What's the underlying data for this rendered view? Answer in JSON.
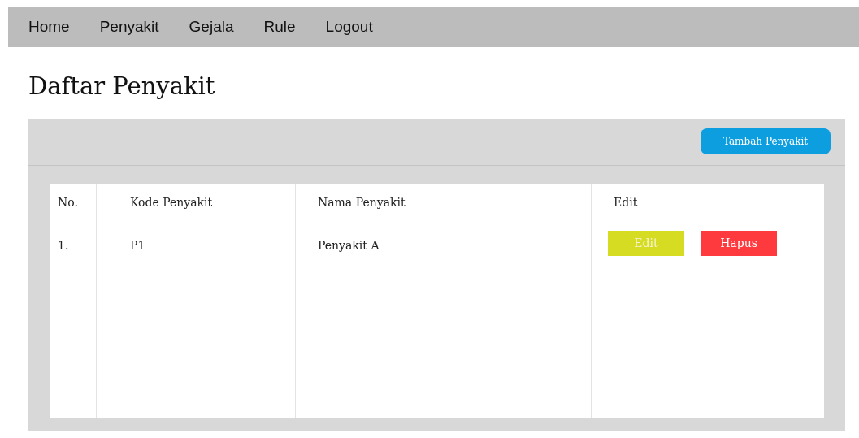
{
  "nav": {
    "items": [
      "Home",
      "Penyakit",
      "Gejala",
      "Rule",
      "Logout"
    ]
  },
  "title": "Daftar Penyakit",
  "add_button": "Tambah Penyakit",
  "table": {
    "columns": [
      "No.",
      "Kode Penyakit",
      "Nama Penyakit",
      "Edit"
    ],
    "rows": [
      {
        "cells": [
          "1.",
          "P1",
          "Penyakit A"
        ],
        "actions": [
          {
            "kind": "edit",
            "label": "Edit"
          },
          {
            "kind": "delete",
            "label": "Hapus"
          }
        ]
      }
    ]
  }
}
